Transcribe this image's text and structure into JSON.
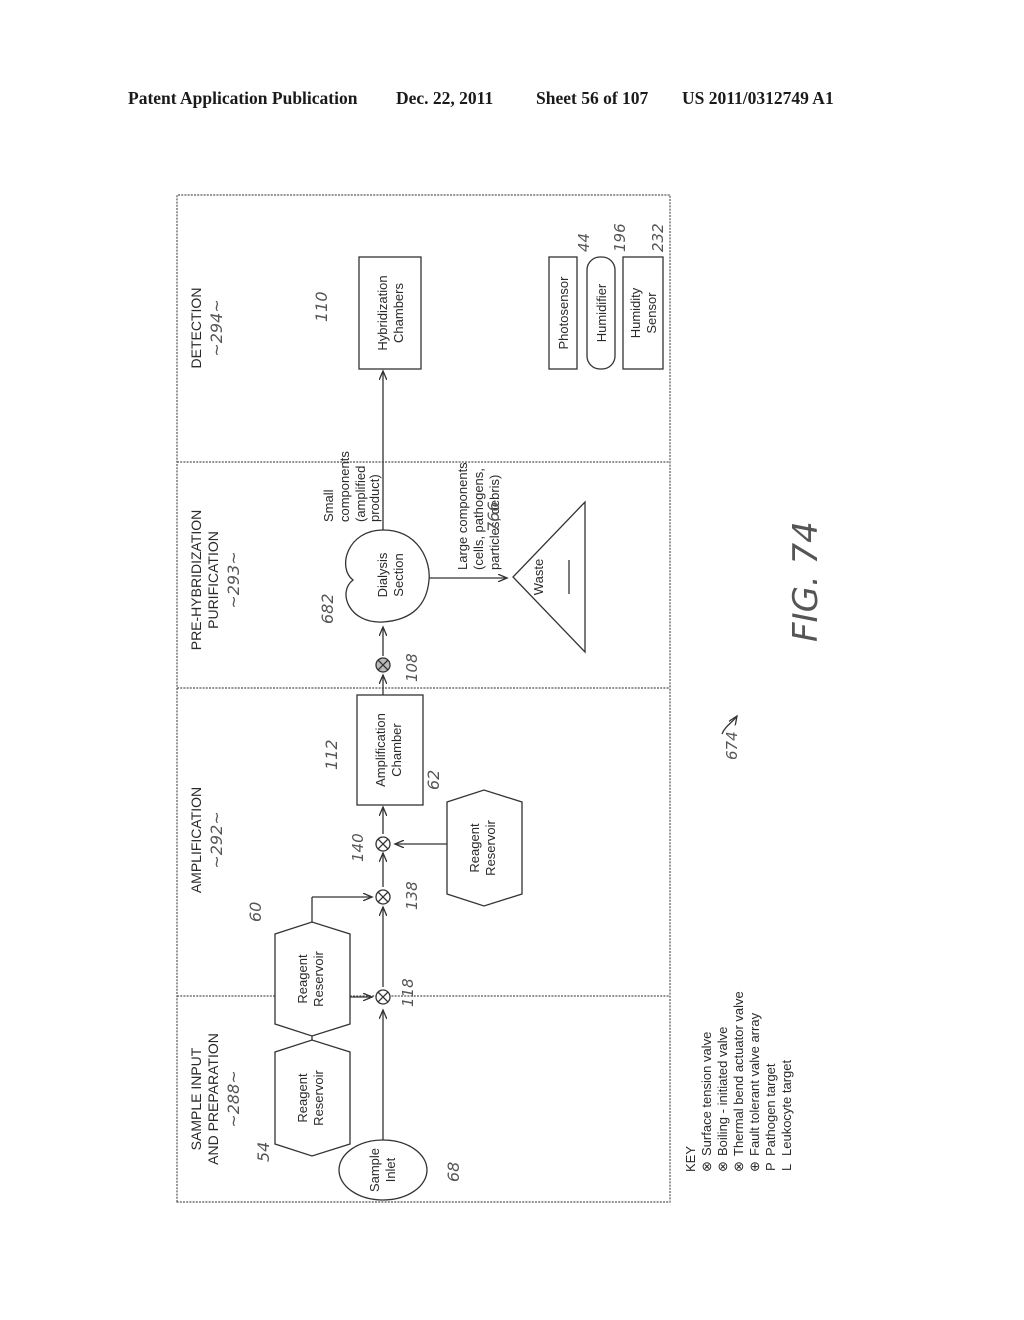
{
  "header": {
    "publication": "Patent Application Publication",
    "date": "Dec. 22, 2011",
    "sheet": "Sheet 56 of 107",
    "number": "US 2011/0312749 A1"
  },
  "figure": {
    "label": "FIG. 74",
    "ref": "674",
    "stages": [
      {
        "line1": "SAMPLE INPUT",
        "line2": "AND PREPARATION",
        "ref": "~288~"
      },
      {
        "line1": "AMPLIFICATION",
        "line2": "",
        "ref": "~292~"
      },
      {
        "line1": "PRE-HYBRIDIZATION",
        "line2": "PURIFICATION",
        "ref": "~293~"
      },
      {
        "line1": "DETECTION",
        "line2": "",
        "ref": "~294~"
      }
    ],
    "nodes": {
      "sample_inlet": {
        "line1": "Sample",
        "line2": "Inlet",
        "ref": "68"
      },
      "reagent_54": {
        "line1": "Reagent",
        "line2": "Reservoir",
        "ref": "54"
      },
      "valve_118": {
        "ref": "118"
      },
      "reagent_60": {
        "line1": "Reagent",
        "line2": "Reservoir",
        "ref": "60"
      },
      "reagent_62": {
        "line1": "Reagent",
        "line2": "Reservoir",
        "ref": "62"
      },
      "valve_138": {
        "ref": "138"
      },
      "valve_140": {
        "ref": "140"
      },
      "amplification": {
        "line1": "Amplification",
        "line2": "Chamber",
        "ref": "112"
      },
      "valve_108": {
        "ref": "108"
      },
      "dialysis": {
        "line1": "Dialysis",
        "line2": "Section",
        "ref": "682"
      },
      "waste": {
        "label": "Waste",
        "ref": "766"
      },
      "hybridization": {
        "line1": "Hybridization",
        "line2": "Chambers",
        "ref": "110"
      },
      "photosensor": {
        "label": "Photosensor",
        "ref": "44"
      },
      "humidifier": {
        "label": "Humidifier",
        "ref": "196"
      },
      "humidity_sensor": {
        "line1": "Humidity",
        "line2": "Sensor",
        "ref": "232"
      }
    },
    "annotations": {
      "small": [
        "Small",
        "components",
        "(amplified",
        "product)"
      ],
      "large": [
        "Large components",
        "(cells, pathogens,",
        "particles, debris)"
      ]
    },
    "key": {
      "title": "KEY",
      "items": [
        {
          "symbol": "⊗",
          "label": "Surface tension valve"
        },
        {
          "symbol": "⊗",
          "label": "Boiling - initiated valve"
        },
        {
          "symbol": "⊗",
          "label": "Thermal bend actuator valve"
        },
        {
          "symbol": "⊕",
          "label": "Fault tolerant valve array"
        },
        {
          "symbol": "P",
          "label": "Pathogen target"
        },
        {
          "symbol": "L",
          "label": "Leukocyte target"
        }
      ]
    }
  }
}
